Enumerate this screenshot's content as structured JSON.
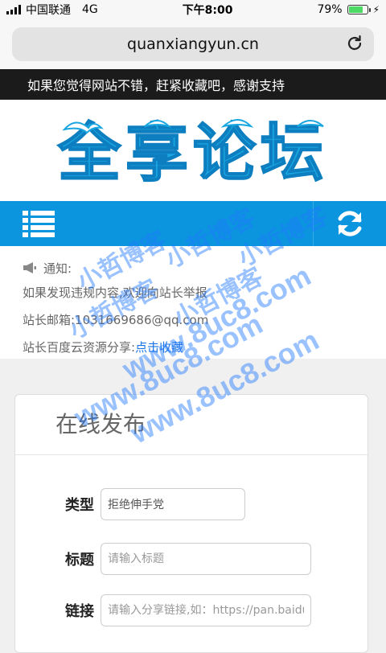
{
  "status": {
    "carrier": "中国联通",
    "network": "4G",
    "time": "下午8:00",
    "battery": "79%"
  },
  "browser": {
    "url": "quanxiangyun.cn"
  },
  "topbar": {
    "text": "如果您觉得网站不错，赶紧收藏吧，感谢支持"
  },
  "logo": {
    "text": "全享论坛"
  },
  "notice": {
    "label": "通知:",
    "line1": "如果发现违规内容,欢迎向站长举报",
    "line2": "站长邮箱:1031669686@qq.com",
    "line3_prefix": "站长百度云资源分享:",
    "line3_link": "点击收藏"
  },
  "form": {
    "title": "在线发布",
    "type_label": "类型",
    "type_value": "拒绝伸手党",
    "title_label": "标题",
    "title_placeholder": "请输入标题",
    "link_label": "链接",
    "link_placeholder": "请输入分享链接,如：https://pan.baidu.com"
  },
  "watermark": {
    "text1": "小哲博客",
    "text2": "www.8uc8.com"
  },
  "colors": {
    "nav": "#0b95de",
    "logo": "#1aa6e0",
    "link": "#1a73e8"
  }
}
